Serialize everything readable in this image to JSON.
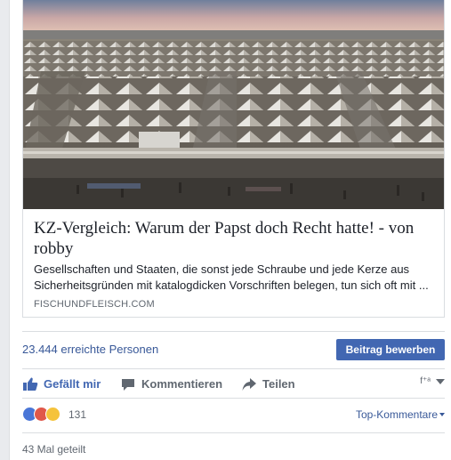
{
  "link_preview": {
    "title": "KZ-Vergleich: Warum der Papst doch Recht hatte! - von robby",
    "description": "Gesellschaften und Staaten, die sonst jede Schraube und jede Kerze aus Sicherheitsgründen mit katalogdicken Vorschriften belegen, tun sich oft mit ...",
    "domain": "FISCHUNDFLEISCH.COM",
    "image_subject": "refugee-camp-tents-photo"
  },
  "reach": {
    "text": "23.444 erreichte Personen",
    "boost_label": "Beitrag bewerben"
  },
  "actions": {
    "like_label": "Gefällt mir",
    "comment_label": "Kommentieren",
    "share_label": "Teilen"
  },
  "summary": {
    "reaction_count": "131",
    "sort_label": "Top-Kommentare",
    "reaction_icons": [
      "like-icon",
      "angry-icon",
      "sad-icon"
    ]
  },
  "shares": {
    "text": "43 Mal geteilt"
  },
  "colors": {
    "facebook_blue": "#4267b2",
    "link_blue": "#385898",
    "muted_gray": "#606770",
    "border": "#dadde1"
  }
}
